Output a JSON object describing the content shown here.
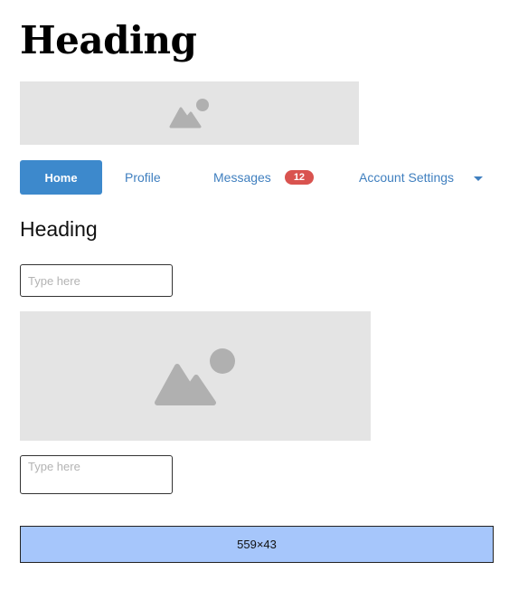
{
  "page": {
    "title": "Heading"
  },
  "nav": {
    "items": [
      {
        "label": "Home",
        "active": true
      },
      {
        "label": "Profile",
        "active": false
      },
      {
        "label": "Messages",
        "active": false,
        "badge": "12"
      },
      {
        "label": "Account Settings",
        "active": false,
        "has_dropdown": true
      }
    ]
  },
  "section": {
    "heading": "Heading"
  },
  "inputs": {
    "first": {
      "placeholder": "Type here",
      "value": ""
    },
    "second": {
      "placeholder": "Type here",
      "value": ""
    }
  },
  "images": {
    "banner_icon": "image-placeholder-icon",
    "large_icon": "image-placeholder-icon"
  },
  "size_box": {
    "label": "559×43"
  },
  "colors": {
    "nav_active_bg": "#3d89cc",
    "nav_link": "#3f7fbf",
    "badge_bg": "#d9534f",
    "placeholder_bg": "#e4e4e4",
    "placeholder_icon": "#b0b0b0",
    "size_box_bg": "#a6c6fb"
  }
}
